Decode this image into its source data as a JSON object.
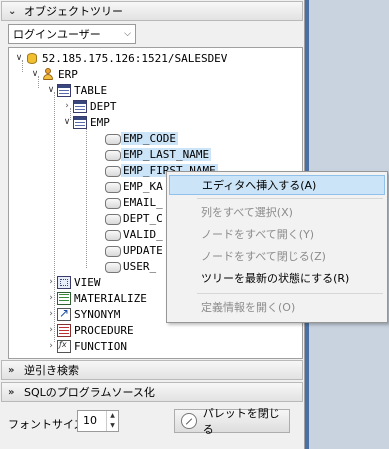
{
  "header": {
    "title": "オブジェクトツリー"
  },
  "combo": {
    "value": "ログインユーザー"
  },
  "tree": {
    "connection": "52.185.175.126:1521/SALESDEV",
    "schema": "ERP",
    "table_folder": "TABLE",
    "tables": [
      "DEPT",
      "EMP"
    ],
    "columns": [
      "EMP_CODE",
      "EMP_LAST_NAME",
      "EMP_FIRST_NAME",
      "EMP_KA",
      "EMAIL_",
      "DEPT_C",
      "VALID_",
      "UPDATE",
      "USER_"
    ],
    "folders": [
      "VIEW",
      "MATERIALIZE",
      "SYNONYM",
      "PROCEDURE",
      "FUNCTION"
    ]
  },
  "context_menu": {
    "items": [
      {
        "label": "エディタへ挿入する(A)",
        "highlighted": true,
        "disabled": false
      },
      {
        "label": "列をすべて選択(X)",
        "disabled": true
      },
      {
        "label": "ノードをすべて開く(Y)",
        "disabled": true
      },
      {
        "label": "ノードをすべて閉じる(Z)",
        "disabled": true
      },
      {
        "label": "ツリーを最新の状態にする(R)",
        "disabled": false
      },
      {
        "label": "定義情報を開く(O)",
        "disabled": true
      }
    ]
  },
  "sections": {
    "reverse_search": "逆引き検索",
    "sql_source": "SQLのプログラムソース化"
  },
  "bottom": {
    "font_size_label": "フォントサイズ",
    "font_size_value": "10",
    "close_palette_label": "パレットを閉じる"
  },
  "colors": {
    "selection": "#cce4f7",
    "highlight_border": "#8fc1ea"
  }
}
